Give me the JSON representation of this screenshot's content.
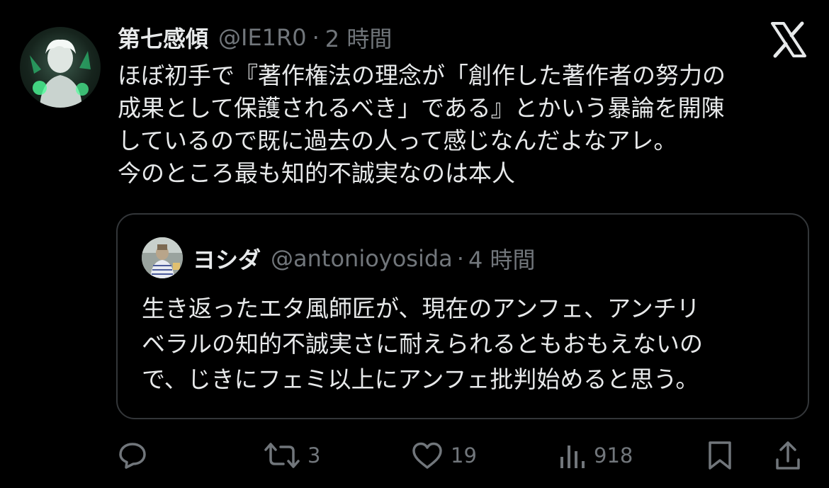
{
  "tweet": {
    "display_name": "第七感傾",
    "handle": "@IE1R0",
    "separator": "·",
    "time": "2 時間",
    "text_lines": [
      "ほぼ初手で『著作権法の理念が「創作した著作者の努力の",
      "成果として保護されるべき」である』とかいう暴論を開陳",
      "しているので既に過去の人って感じなんだよなアレ。",
      "今のところ最も知的不誠実なのは本人"
    ]
  },
  "quote": {
    "display_name": "ヨシダ",
    "handle": "@antonioyosida",
    "separator": "·",
    "time": "4 時間",
    "text_lines": [
      "生き返ったエタ風師匠が、現在のアンフェ、アンチリ",
      "ベラルの知的不誠実さに耐えられるともおもえないの",
      "で、じきにフェミ以上にアンフェ批判始めると思う。"
    ]
  },
  "actions": {
    "reply_icon": "reply-icon",
    "retweet_icon": "retweet-icon",
    "retweet_count": "3",
    "like_icon": "like-icon",
    "like_count": "19",
    "views_icon": "views-icon",
    "views_count": "918",
    "bookmark_icon": "bookmark-icon",
    "share_icon": "share-icon"
  },
  "brand_icon": "x-logo-icon",
  "colors": {
    "background": "#000000",
    "text_primary": "#e7e9ea",
    "text_secondary": "#71767b",
    "border": "#333639"
  }
}
